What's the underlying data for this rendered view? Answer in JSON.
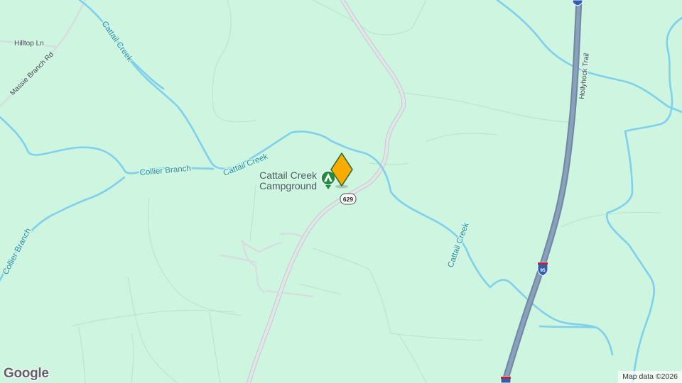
{
  "map": {
    "background_color": "#cdf5df",
    "water_color": "#7fd0ec",
    "minor_road_color": "#d9dde0",
    "interstate_color": "#7f99b5",
    "marker_color": "#f9ab00",
    "poi_color": "#1e8e3e"
  },
  "labels": {
    "hilltop_ln": "Hilltop Ln",
    "massie_branch_rd": "Massie Branch Rd",
    "cattail_creek_1": "Cattail Creek",
    "cattail_creek_2": "Cattail Creek",
    "cattail_creek_3": "Cattail Creek",
    "collier_branch_1": "Collier Branch",
    "collier_branch_2": "Collier Branch",
    "hollyhock_trail": "Hollyhock Trail"
  },
  "poi": {
    "name_line1": "Cattail Creek",
    "name_line2": "Campground",
    "icon": "campground-icon"
  },
  "shields": {
    "state_route": "629",
    "interstate": "95"
  },
  "marker": {
    "icon": "location-pin-icon"
  },
  "footer": {
    "logo": "Google",
    "attribution": "Map data ©2026"
  }
}
